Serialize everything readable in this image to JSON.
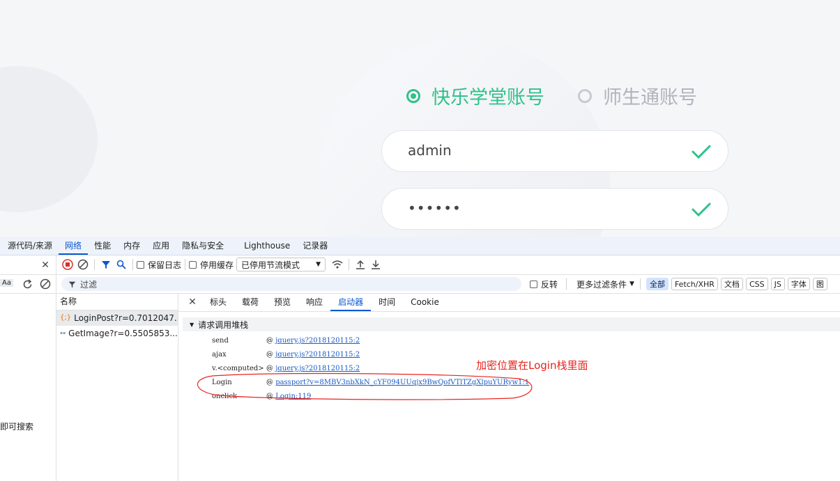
{
  "login": {
    "tab_active": "快乐学堂账号",
    "tab_inactive": "师生通账号",
    "username": "admin",
    "password": "••••••"
  },
  "devtools": {
    "panel_tabs": [
      "源代码/来源",
      "网络",
      "性能",
      "内存",
      "应用",
      "隐私与安全",
      "Lighthouse",
      "记录器"
    ],
    "active_panel": "网络",
    "toolbar": {
      "preserve_log": "保留日志",
      "disable_cache": "停用缓存",
      "throttle": "已停用节流模式"
    },
    "filter": {
      "placeholder": "过滤",
      "invert": "反转",
      "more_filters": "更多过滤条件",
      "types": [
        "全部",
        "Fetch/XHR",
        "文档",
        "CSS",
        "JS",
        "字体",
        "图"
      ]
    },
    "left_aa": "Aa",
    "left_hint": "即可搜索",
    "names_header": "名称",
    "requests": [
      {
        "name": "LoginPost?r=0.7012047...",
        "icon": "{;}"
      },
      {
        "name": "GetImage?r=0.5505853...",
        "icon": "▪▪"
      }
    ],
    "detail_tabs": [
      "标头",
      "载荷",
      "预览",
      "响应",
      "启动器",
      "时间",
      "Cookie"
    ],
    "active_detail_tab": "启动器",
    "stack_title": "请求调用堆栈",
    "stack": [
      {
        "fn": "send",
        "loc": "jquery.js?2018120115:2"
      },
      {
        "fn": "ajax",
        "loc": "jquery.js?2018120115:2"
      },
      {
        "fn": "v.<computed>",
        "loc": "jquery.js?2018120115:2"
      },
      {
        "fn": "Login",
        "loc": "passport?v=8MBV3nbXkN_cYF094UUqjx9BwQofVTlTZgXlpuYURyw1:1"
      },
      {
        "fn": "onclick",
        "loc": "Login:119"
      }
    ],
    "annotation": "加密位置在Login栈里面"
  },
  "colors": {
    "accent_green": "#2fc289",
    "devtools_blue": "#0b57d0",
    "annotation_red": "#e8231e"
  }
}
